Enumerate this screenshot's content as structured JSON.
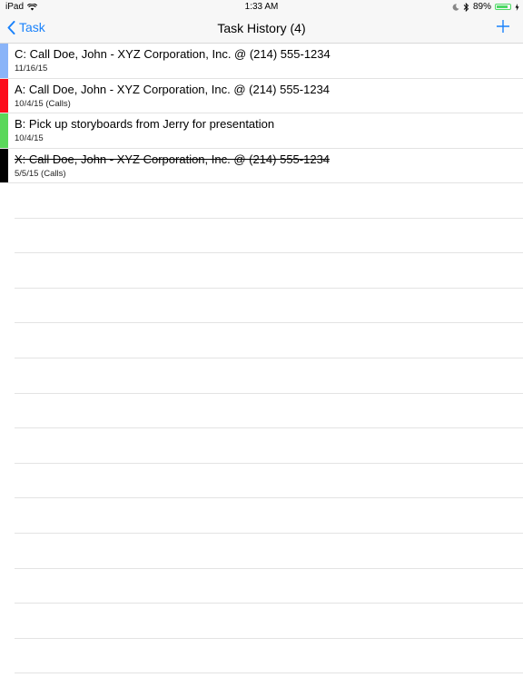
{
  "status_bar": {
    "device": "iPad",
    "time": "1:33 AM",
    "battery_percent": "89%",
    "battery_level": 0.89
  },
  "nav": {
    "back_label": "Task",
    "title": "Task History (4)"
  },
  "tasks": [
    {
      "title": "C: Call Doe, John - XYZ Corporation, Inc. @ (214) 555-1234",
      "subtitle": "11/16/15",
      "color": "#8ab4f8",
      "done": false
    },
    {
      "title": "A: Call Doe, John - XYZ Corporation, Inc. @ (214) 555-1234",
      "subtitle": "10/4/15 (Calls)",
      "color": "#fc0d1b",
      "done": false
    },
    {
      "title": "B: Pick up storyboards from Jerry for presentation",
      "subtitle": "10/4/15",
      "color": "#5ad75a",
      "done": false
    },
    {
      "title": "X: Call Doe, John - XYZ Corporation, Inc. @ (214) 555-1234",
      "subtitle": "5/5/15 (Calls)",
      "color": "#000000",
      "done": true
    }
  ],
  "colors": {
    "accent": "#1a82fb",
    "battery": "#4cd964"
  }
}
